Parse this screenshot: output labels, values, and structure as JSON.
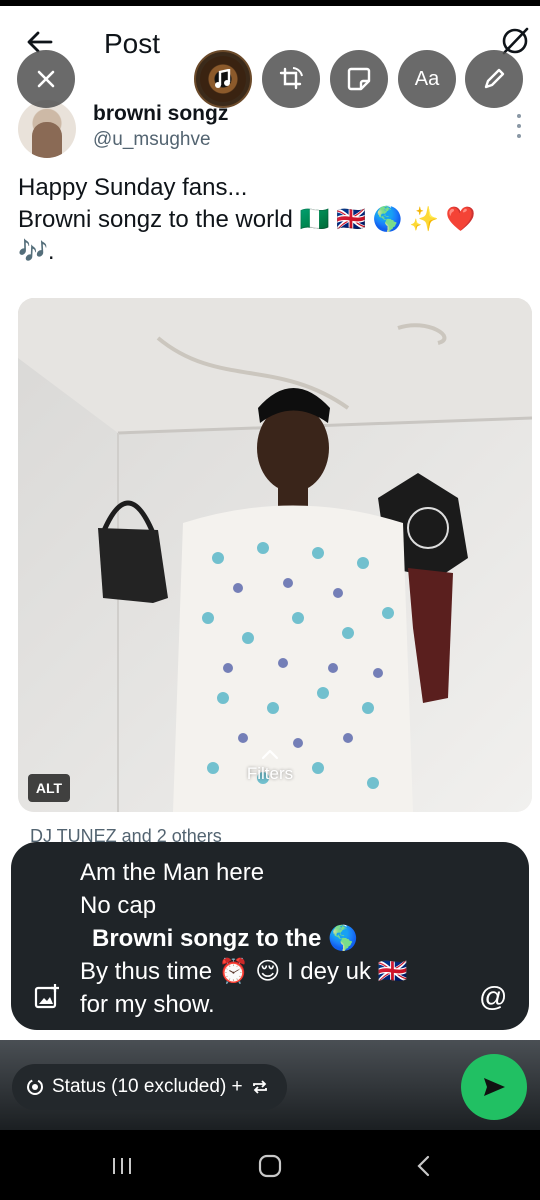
{
  "header": {
    "title": "Post"
  },
  "editor_tools": {
    "close": "close-icon",
    "music": "music-icon",
    "crop_rotate": "crop-rotate-icon",
    "sticker": "sticker-icon",
    "text_label": "Aa",
    "draw": "pen-icon"
  },
  "post": {
    "author_name": "browni songz",
    "author_handle": "@u_msughve",
    "text_line1": "Happy Sunday fans...",
    "text_line2": "Browni songz to the world 🇳🇬 🇬🇧 🌎 ✨ ❤️",
    "text_line3": "🎶.",
    "alt_label": "ALT",
    "filters_label": "Filters",
    "tagged_partial": "DJ TUNEZ and 2 others"
  },
  "caption": {
    "line1": "Am the Man here",
    "line2": "No cap",
    "line3": "Browni songz to the 🌎",
    "line4": "By thus time ⏰ 😌 I dey uk 🇬🇧",
    "line5": "for my show."
  },
  "bottom": {
    "status_label": "Status (10 excluded) +",
    "send": "send-icon"
  },
  "colors": {
    "caption_bg": "#1f2428",
    "send_green": "#21c063",
    "handle_gray": "#536471"
  }
}
